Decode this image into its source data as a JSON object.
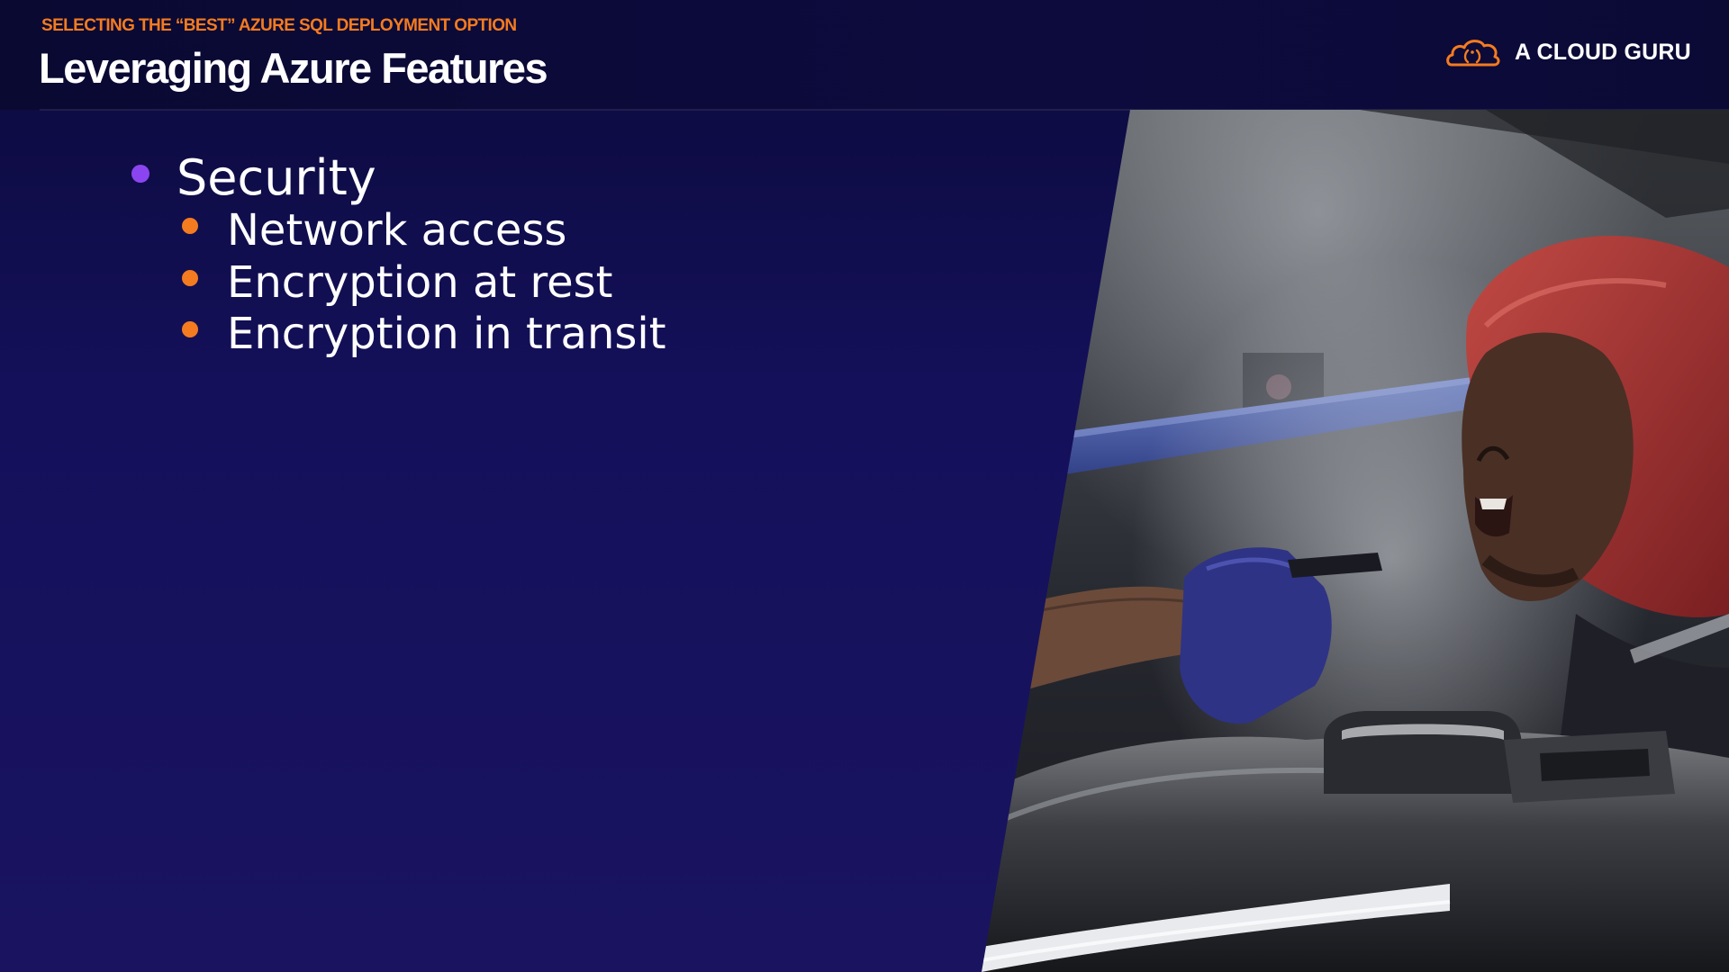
{
  "header": {
    "eyebrow": "SELECTING THE “BEST” AZURE SQL DEPLOYMENT OPTION",
    "title": "Leveraging Azure Features"
  },
  "brand": {
    "name": "A CLOUD GURU",
    "logo_icon": "cloud-logo-icon"
  },
  "bullets": [
    {
      "level": 1,
      "text": "Security",
      "marker_color": "#8b45f0"
    },
    {
      "level": 2,
      "text": "Network access",
      "marker_color": "#f47b20"
    },
    {
      "level": 2,
      "text": "Encryption at rest",
      "marker_color": "#f47b20"
    },
    {
      "level": 2,
      "text": "Encryption in transit",
      "marker_color": "#f47b20"
    }
  ],
  "colors": {
    "background": "#14105a",
    "accent_orange": "#f47b20",
    "accent_purple": "#8b45f0",
    "text": "#ffffff"
  }
}
